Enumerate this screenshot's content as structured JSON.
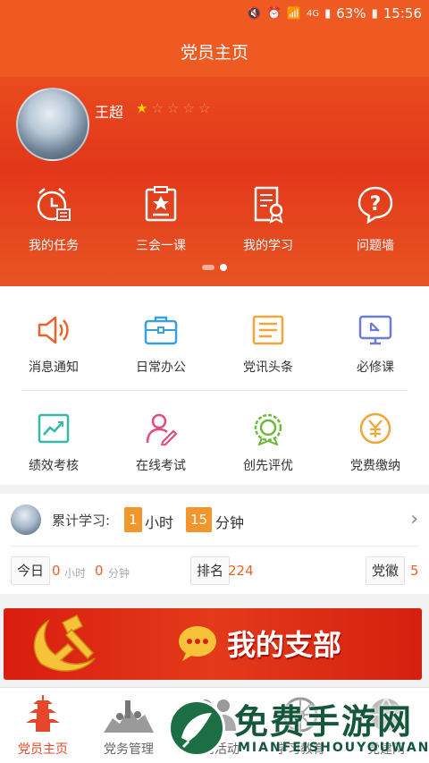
{
  "status_bar": {
    "battery": "63%",
    "time": "15:56",
    "network": "4G"
  },
  "header": {
    "title": "党员主页"
  },
  "profile": {
    "name": "王超",
    "rating": 1,
    "rating_max": 5
  },
  "quick_menu": {
    "items": [
      {
        "label": "我的任务",
        "icon": "alarm-clock-icon"
      },
      {
        "label": "三会一课",
        "icon": "badge-star-icon"
      },
      {
        "label": "我的学习",
        "icon": "document-award-icon"
      },
      {
        "label": "问题墙",
        "icon": "question-bubble-icon"
      }
    ],
    "page_count": 2,
    "current_page": 2
  },
  "grid_menu": {
    "items": [
      {
        "label": "消息通知",
        "icon": "speaker-icon",
        "color": "#e8642a"
      },
      {
        "label": "日常办公",
        "icon": "briefcase-icon",
        "color": "#3aa0d8"
      },
      {
        "label": "党讯头条",
        "icon": "news-icon",
        "color": "#f2a53a"
      },
      {
        "label": "必修课",
        "icon": "monitor-icon",
        "color": "#6b7bd6"
      },
      {
        "label": "绩效考核",
        "icon": "chart-icon",
        "color": "#33b9ad"
      },
      {
        "label": "在线考试",
        "icon": "person-pen-icon",
        "color": "#e24d7a"
      },
      {
        "label": "创先评优",
        "icon": "medal-icon",
        "color": "#6cb83a"
      },
      {
        "label": "党费缴纳",
        "icon": "yuan-coin-icon",
        "color": "#f2a53a"
      }
    ]
  },
  "study": {
    "cumulative_label": "累计学习:",
    "hours": "1",
    "hours_unit": "小时",
    "minutes": "15",
    "minutes_unit": "分钟",
    "today_label": "今日",
    "today_hours": "0",
    "today_hours_unit": "小时",
    "today_minutes": "0",
    "today_minutes_unit": "分钟",
    "rank_label": "排名",
    "rank_value": "224",
    "badge_label": "党徽",
    "badge_value": "5"
  },
  "banner": {
    "text": "我的支部"
  },
  "tabbar": {
    "tabs": [
      {
        "label": "党员主页",
        "active": true
      },
      {
        "label": "党务管理"
      },
      {
        "label": "党内活动"
      },
      {
        "label": "学习教育"
      },
      {
        "label": "党建网"
      }
    ]
  },
  "watermark": {
    "title": "免费手游网",
    "subtitle": "MIANFEISHOUYOUWANG"
  },
  "colors": {
    "primary": "#ee5a22",
    "accent_orange": "#f2952a",
    "value_orange": "#e8642a"
  }
}
